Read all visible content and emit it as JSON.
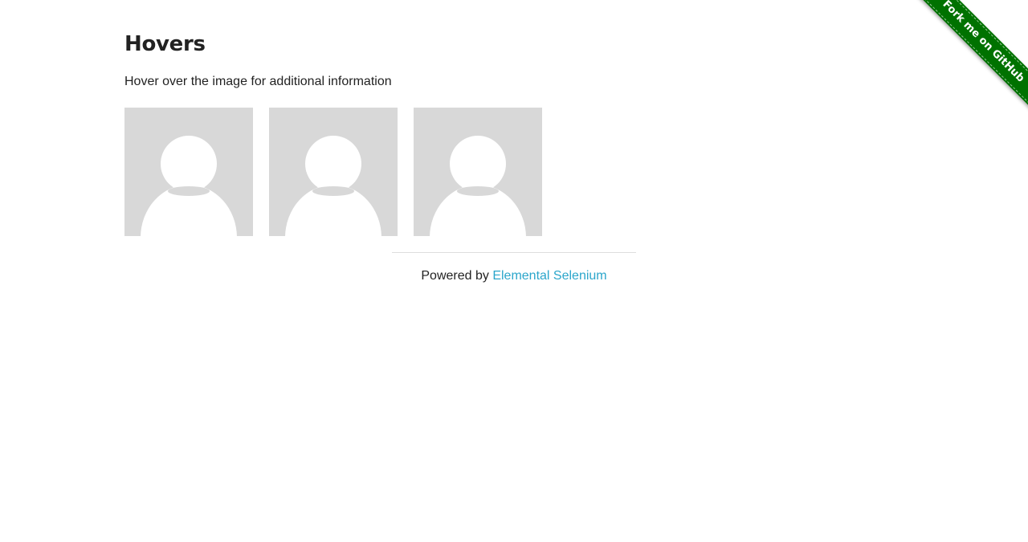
{
  "page": {
    "title": "Hovers",
    "instructions": "Hover over the image for additional information"
  },
  "figures": [
    {
      "image_icon": "user-avatar-icon"
    },
    {
      "image_icon": "user-avatar-icon"
    },
    {
      "image_icon": "user-avatar-icon"
    }
  ],
  "footer": {
    "powered_by": "Powered by",
    "link_text": "Elemental Selenium"
  },
  "ribbon": {
    "text": "Fork me on GitHub",
    "color": "#007200"
  },
  "colors": {
    "link": "#2ba6cb",
    "avatar_bg": "#d8d8d8"
  }
}
